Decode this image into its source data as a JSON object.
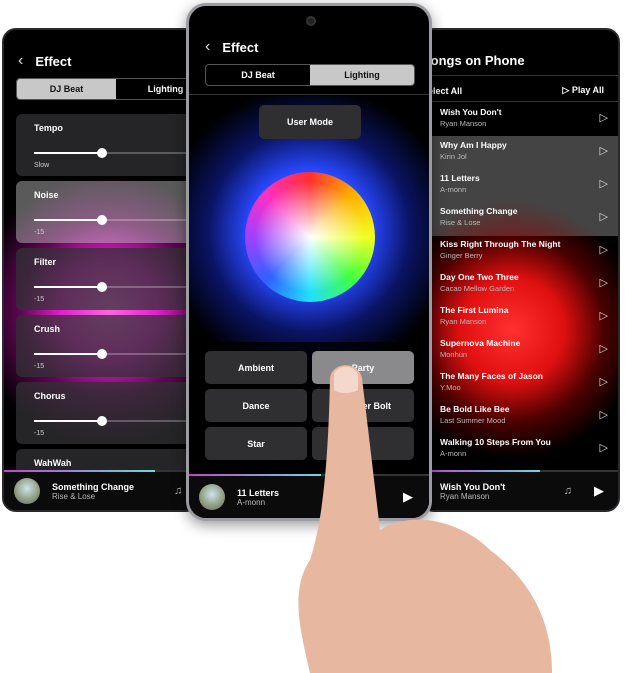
{
  "left_phone": {
    "title": "Effect",
    "tabs": [
      "DJ Beat",
      "Lighting"
    ],
    "controls": [
      {
        "label": "Tempo",
        "caption": "Slow",
        "value": 0.5
      },
      {
        "label": "Noise",
        "caption": "-15",
        "value": 0.5
      },
      {
        "label": "Filter",
        "caption": "-15",
        "value": 0.5
      },
      {
        "label": "Crush",
        "caption": "-15",
        "value": 0.5
      },
      {
        "label": "Chorus",
        "caption": "-15",
        "value": 0.5
      },
      {
        "label": "WahWah",
        "caption": "",
        "value": 0.5
      }
    ],
    "now_playing": {
      "title": "Something Change",
      "artist": "Rise & Lose",
      "progress": 0.78
    },
    "glow_color": "#e020c8"
  },
  "center_phone": {
    "title": "Effect",
    "tabs": [
      "DJ Beat",
      "Lighting"
    ],
    "user_mode": "User Mode",
    "modes": [
      "Ambient",
      "Party",
      "Dance",
      "Thunder Bolt",
      "Star",
      ""
    ],
    "now_playing": {
      "title": "11 Letters",
      "artist": "A-monn",
      "progress": 0.55
    }
  },
  "right_phone": {
    "title": "Songs on Phone",
    "select_all": "Select All",
    "play_all": "Play All",
    "songs": [
      {
        "title": "Wish You Don't",
        "artist": "Ryan Manson"
      },
      {
        "title": "Why Am I Happy",
        "artist": "Kirin Jol"
      },
      {
        "title": "11 Letters",
        "artist": "A-monn"
      },
      {
        "title": "Something Change",
        "artist": "Rise & Lose"
      },
      {
        "title": "Kiss Right Through The Night",
        "artist": "Ginger Berry"
      },
      {
        "title": "Day One Two Three",
        "artist": "Cacao Mellow Garden"
      },
      {
        "title": "The First Lumina",
        "artist": "Ryan Manson"
      },
      {
        "title": "Supernova Machine",
        "artist": "Monhun"
      },
      {
        "title": "The Many Faces of Jason",
        "artist": "Y.Moo"
      },
      {
        "title": "Be Bold Like Bee",
        "artist": "Last Summer Mood"
      },
      {
        "title": "Walking 10 Steps From You",
        "artist": "A-monn"
      }
    ],
    "now_playing": {
      "title": "Wish You Don't",
      "artist": "Ryan Manson",
      "progress": 0.6
    },
    "glow_color": "#e01010"
  }
}
